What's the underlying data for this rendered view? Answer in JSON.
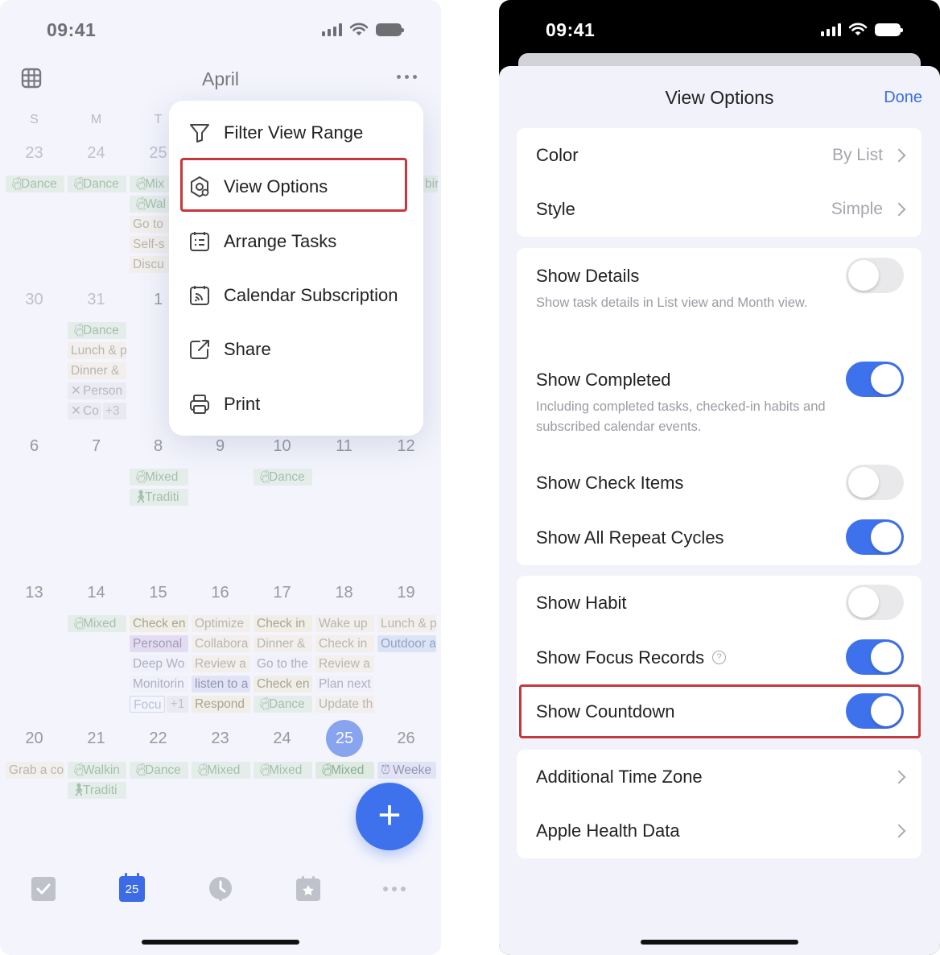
{
  "left_screen": {
    "status_bar": {
      "time": "09:41"
    },
    "header": {
      "month": "April"
    },
    "weekdays": [
      "S",
      "M",
      "T"
    ],
    "weeks": [
      {
        "days": [
          "23",
          "24",
          "25",
          "",
          "",
          "",
          ""
        ]
      },
      {
        "days": [
          "30",
          "31",
          "1",
          "",
          "",
          "",
          ""
        ]
      },
      {
        "days": [
          "6",
          "7",
          "8",
          "9",
          "10",
          "11",
          "12"
        ]
      },
      {
        "days": [
          "13",
          "14",
          "15",
          "16",
          "17",
          "18",
          "19"
        ]
      },
      {
        "days": [
          "20",
          "21",
          "22",
          "23",
          "24",
          "25",
          "26"
        ]
      }
    ],
    "events": {
      "w1": [
        "Dance",
        "Dance",
        "Mix",
        "Wal",
        "Go to",
        "Self-s",
        "Discu",
        "bir"
      ],
      "w2": [
        "Dance",
        "Lunch & p",
        "Dinner &",
        "Person",
        "Co",
        "+3"
      ],
      "w3": [
        "Mixed",
        "Traditi",
        "Dance"
      ],
      "w4": [
        "Mixed",
        "Check en",
        "Personal",
        "Deep Wo",
        "Monitorin",
        "Focu",
        "+1",
        "Optimize",
        "Collabora",
        "Review a",
        "listen to a",
        "Respond",
        "Check in",
        "Dinner &",
        "Go to the",
        "Check en",
        "Dance",
        "Wake up",
        "Check in",
        "Review a",
        "Plan next",
        "Update th",
        "Lunch & p",
        "Outdoor a"
      ],
      "w5": [
        "Grab a co",
        "Walkin",
        "Traditi",
        "Dance",
        "Mixed",
        "Mixed",
        "Mixed",
        "Weeke"
      ]
    },
    "tab_bar": {
      "calendar_day": "25"
    },
    "fab": {
      "label": "+"
    },
    "menu": {
      "items": [
        {
          "label": "Filter View Range",
          "icon": "filter-icon"
        },
        {
          "label": "View Options",
          "icon": "view-options-icon"
        },
        {
          "label": "Arrange Tasks",
          "icon": "arrange-tasks-icon"
        },
        {
          "label": "Calendar Subscription",
          "icon": "calendar-subscription-icon"
        },
        {
          "label": "Share",
          "icon": "share-icon"
        },
        {
          "label": "Print",
          "icon": "print-icon"
        }
      ]
    }
  },
  "right_screen": {
    "status_bar": {
      "time": "09:41"
    },
    "sheet": {
      "title": "View Options",
      "done_label": "Done",
      "color_row": {
        "label": "Color",
        "value": "By List"
      },
      "style_row": {
        "label": "Style",
        "value": "Simple"
      },
      "show_details": {
        "label": "Show Details",
        "desc": "Show task details in List view and Month view.",
        "on": false
      },
      "show_completed": {
        "label": "Show Completed",
        "desc": "Including completed tasks, checked-in habits and subscribed calendar events.",
        "on": true
      },
      "show_check_items": {
        "label": "Show Check Items",
        "on": false
      },
      "show_all_repeat_cycles": {
        "label": "Show All Repeat Cycles",
        "on": true
      },
      "show_habit": {
        "label": "Show Habit",
        "on": false
      },
      "show_focus_records": {
        "label": "Show Focus Records",
        "help": "?",
        "on": true
      },
      "show_countdown": {
        "label": "Show Countdown",
        "on": true
      },
      "additional_time_zone": {
        "label": "Additional Time Zone"
      },
      "apple_health_data": {
        "label": "Apple Health Data"
      }
    }
  },
  "colors": {
    "accent": "#3e72ec",
    "highlight_border": "#c8373d",
    "left_background": "#f3f4fc",
    "sheet_background": "#f2f3fa"
  }
}
